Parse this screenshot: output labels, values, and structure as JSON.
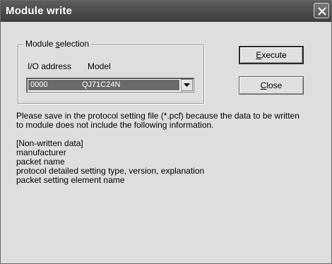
{
  "window": {
    "title": "Module write",
    "close_icon": "close-icon"
  },
  "module_selection": {
    "label_prefix": "Module ",
    "label_mnemonic": "s",
    "label_suffix": "election",
    "col_io": "I/O address",
    "col_model": "Model",
    "selected_io": "0000",
    "selected_model": "QJ71C24N",
    "dropdown_icon": "chevron-down-icon"
  },
  "buttons": {
    "execute_mnemonic": "E",
    "execute_rest": "xecute",
    "close_mnemonic": "C",
    "close_rest": "lose"
  },
  "message": {
    "line1": "Please save in the protocol setting file (*.pcf) because the data to be written",
    "line2": "to module does not include the following information.",
    "header": "[Non-written data]",
    "items": [
      "manufacturer",
      "packet name",
      "protocol detailed setting type, version, explanation",
      "packet setting element name"
    ]
  }
}
